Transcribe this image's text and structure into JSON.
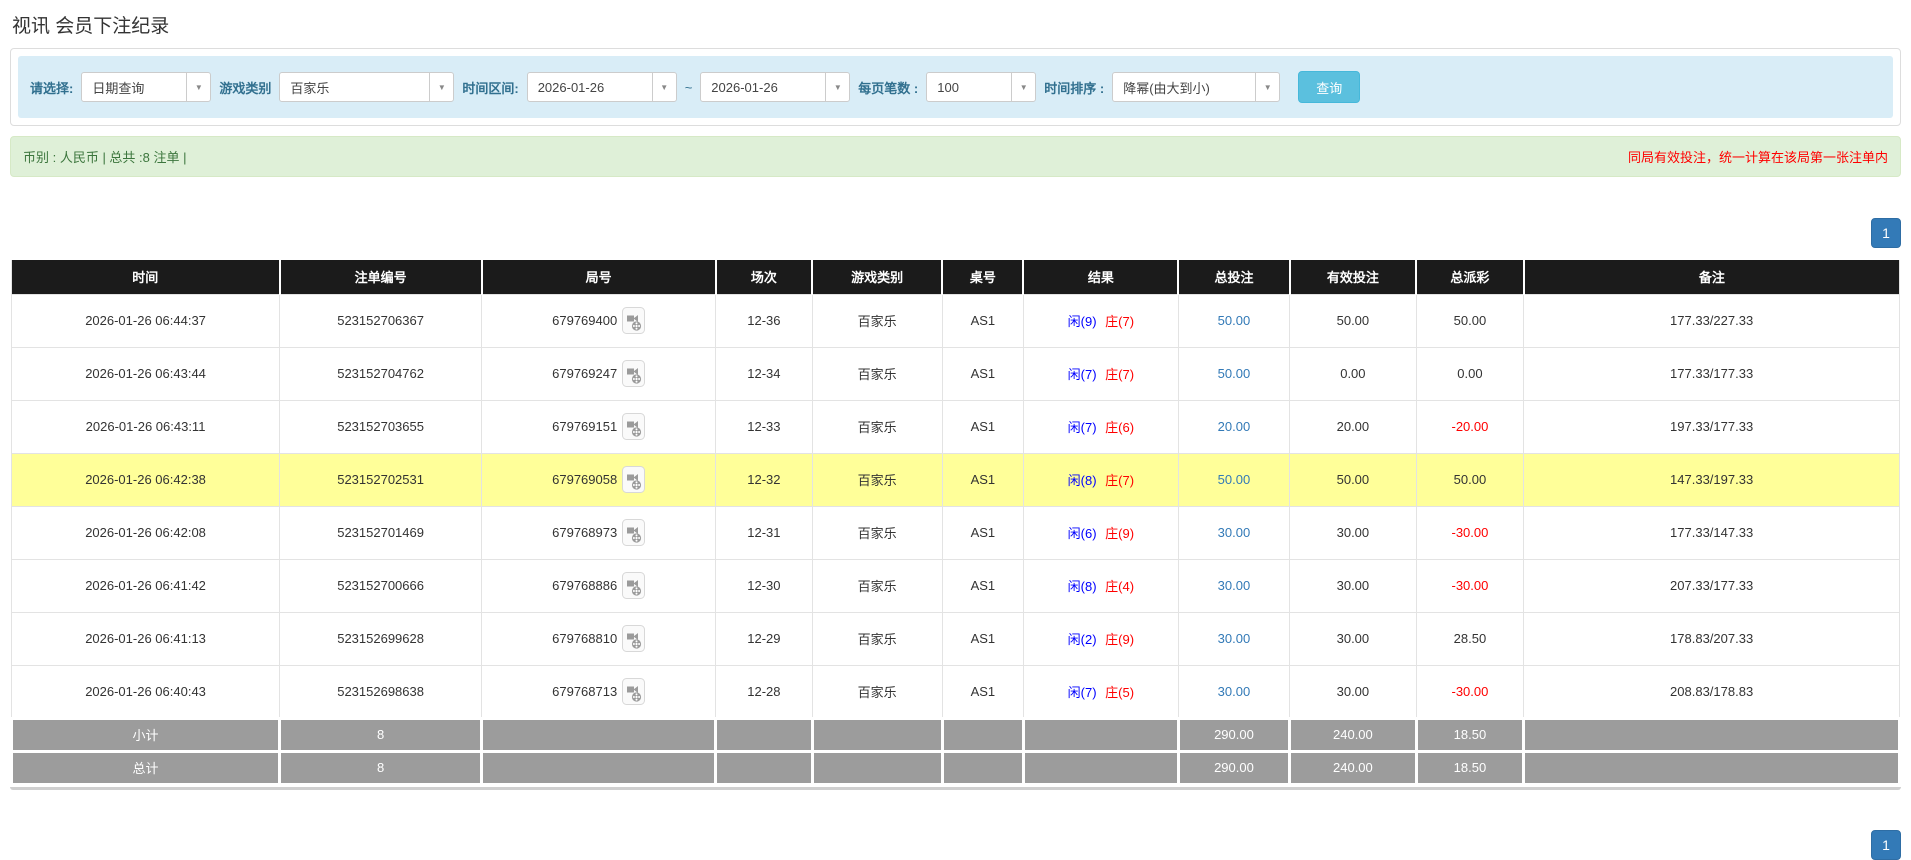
{
  "page": {
    "title": "视讯 会员下注纪录"
  },
  "filters": {
    "select_type": {
      "label": "请选择:",
      "value": "日期查询"
    },
    "game_type": {
      "label": "游戏类别",
      "value": "百家乐"
    },
    "date_range": {
      "label": "时间区间:",
      "from": "2026-01-26",
      "separator": "~",
      "to": "2026-01-26"
    },
    "page_size": {
      "label": "每页笔数 :",
      "value": "100"
    },
    "time_sort": {
      "label": "时间排序 :",
      "value": "降幂(由大到小)"
    },
    "search_button": "查询"
  },
  "summary": {
    "left": "币别 : 人民币 | 总共 :8 注单 |",
    "right_note": "同局有效投注，统一计算在该局第一张注单内"
  },
  "pagination": {
    "page": "1"
  },
  "table": {
    "columns": [
      "时间",
      "注单编号",
      "局号",
      "场次",
      "游戏类别",
      "桌号",
      "结果",
      "总投注",
      "有效投注",
      "总派彩",
      "备注"
    ],
    "rows": [
      {
        "time": "2026-01-26 06:44:37",
        "bet_no": "523152706367",
        "round_no": "679769400",
        "session": "12-36",
        "game": "百家乐",
        "table_no": "AS1",
        "result_player": "闲(9)",
        "result_banker": "庄(7)",
        "total_bet": "50.00",
        "valid_bet": "50.00",
        "payout": "50.00",
        "payout_negative": false,
        "remark": "177.33/227.33",
        "highlight": false
      },
      {
        "time": "2026-01-26 06:43:44",
        "bet_no": "523152704762",
        "round_no": "679769247",
        "session": "12-34",
        "game": "百家乐",
        "table_no": "AS1",
        "result_player": "闲(7)",
        "result_banker": "庄(7)",
        "total_bet": "50.00",
        "valid_bet": "0.00",
        "payout": "0.00",
        "payout_negative": false,
        "remark": "177.33/177.33",
        "highlight": false
      },
      {
        "time": "2026-01-26 06:43:11",
        "bet_no": "523152703655",
        "round_no": "679769151",
        "session": "12-33",
        "game": "百家乐",
        "table_no": "AS1",
        "result_player": "闲(7)",
        "result_banker": "庄(6)",
        "total_bet": "20.00",
        "valid_bet": "20.00",
        "payout": "-20.00",
        "payout_negative": true,
        "remark": "197.33/177.33",
        "highlight": false
      },
      {
        "time": "2026-01-26 06:42:38",
        "bet_no": "523152702531",
        "round_no": "679769058",
        "session": "12-32",
        "game": "百家乐",
        "table_no": "AS1",
        "result_player": "闲(8)",
        "result_banker": "庄(7)",
        "total_bet": "50.00",
        "valid_bet": "50.00",
        "payout": "50.00",
        "payout_negative": false,
        "remark": "147.33/197.33",
        "highlight": true
      },
      {
        "time": "2026-01-26 06:42:08",
        "bet_no": "523152701469",
        "round_no": "679768973",
        "session": "12-31",
        "game": "百家乐",
        "table_no": "AS1",
        "result_player": "闲(6)",
        "result_banker": "庄(9)",
        "total_bet": "30.00",
        "valid_bet": "30.00",
        "payout": "-30.00",
        "payout_negative": true,
        "remark": "177.33/147.33",
        "highlight": false
      },
      {
        "time": "2026-01-26 06:41:42",
        "bet_no": "523152700666",
        "round_no": "679768886",
        "session": "12-30",
        "game": "百家乐",
        "table_no": "AS1",
        "result_player": "闲(8)",
        "result_banker": "庄(4)",
        "total_bet": "30.00",
        "valid_bet": "30.00",
        "payout": "-30.00",
        "payout_negative": true,
        "remark": "207.33/177.33",
        "highlight": false
      },
      {
        "time": "2026-01-26 06:41:13",
        "bet_no": "523152699628",
        "round_no": "679768810",
        "session": "12-29",
        "game": "百家乐",
        "table_no": "AS1",
        "result_player": "闲(2)",
        "result_banker": "庄(9)",
        "total_bet": "30.00",
        "valid_bet": "30.00",
        "payout": "28.50",
        "payout_negative": false,
        "remark": "178.83/207.33",
        "highlight": false
      },
      {
        "time": "2026-01-26 06:40:43",
        "bet_no": "523152698638",
        "round_no": "679768713",
        "session": "12-28",
        "game": "百家乐",
        "table_no": "AS1",
        "result_player": "闲(7)",
        "result_banker": "庄(5)",
        "total_bet": "30.00",
        "valid_bet": "30.00",
        "payout": "-30.00",
        "payout_negative": true,
        "remark": "208.83/178.83",
        "highlight": false
      }
    ],
    "totals": [
      {
        "label": "小计",
        "count": "8",
        "total_bet": "290.00",
        "valid_bet": "240.00",
        "payout": "18.50"
      },
      {
        "label": "总计",
        "count": "8",
        "total_bet": "290.00",
        "valid_bet": "240.00",
        "payout": "18.50"
      }
    ]
  },
  "colors": {
    "header_black": "#1b1b1b",
    "footer_gray": "#9c9c9c",
    "highlight_yellow": "#ffff99",
    "filter_bar_blue": "#d9edf7",
    "summary_green": "#dff0d8",
    "search_button_blue": "#5bc0de",
    "pagination_blue": "#337ab7",
    "bet_link_blue": "#337ab7",
    "player_blue": "#0000ff",
    "banker_red": "#ff0000",
    "negative_red": "#ff0000"
  },
  "icons": {
    "dropdown_caret": "caret-down",
    "round_video": "video-replay"
  }
}
